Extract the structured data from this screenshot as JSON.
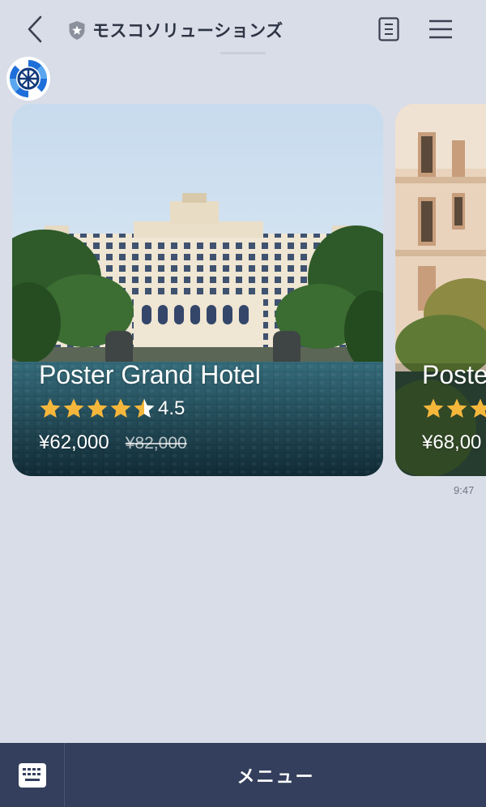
{
  "header": {
    "title": "モスコソリューションズ"
  },
  "cards": [
    {
      "name": "Poster Grand Hotel",
      "rating": "4.5",
      "rating_value": 4.5,
      "price": "¥62,000",
      "old_price": "¥82,000"
    },
    {
      "name": "Poste",
      "rating_value": 3,
      "price": "¥68,00"
    }
  ],
  "chat": {
    "timestamp": "9:47"
  },
  "bottom_bar": {
    "menu_label": "メニュー"
  },
  "colors": {
    "star": "#f5b73b",
    "bottom_bar": "#333f5c",
    "background": "#d8dde8"
  },
  "icons": {
    "back": "chevron-left-icon",
    "verified": "shield-star-icon",
    "notes": "note-icon",
    "menu": "hamburger-icon",
    "keyboard": "keyboard-icon"
  }
}
